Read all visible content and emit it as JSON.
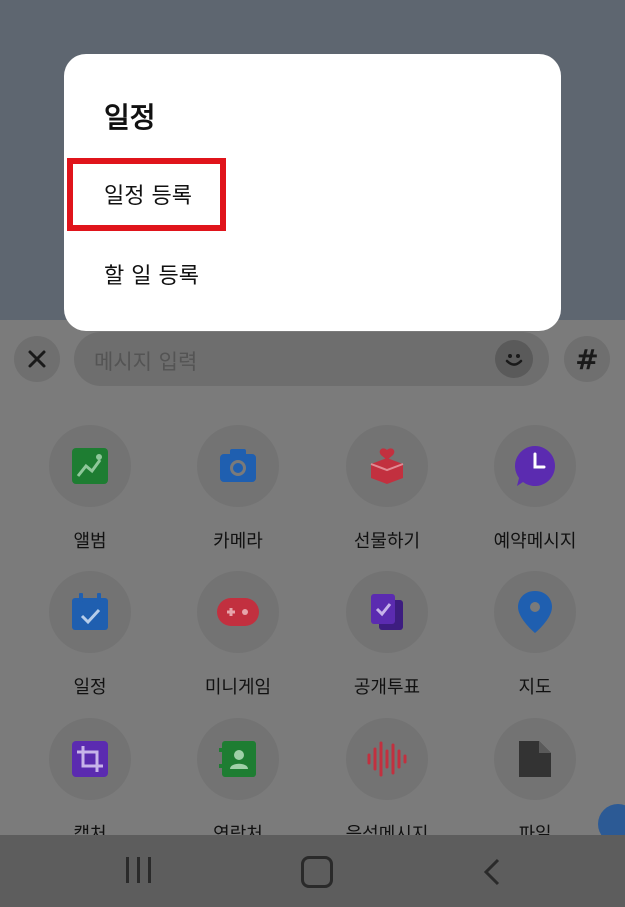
{
  "popup": {
    "title": "일정",
    "options": [
      "일정 등록",
      "할 일 등록"
    ]
  },
  "input": {
    "placeholder": "메시지 입력",
    "hash_label": "#"
  },
  "grid": [
    {
      "label": "앨범",
      "icon": "album-icon",
      "color": "#1e7d32"
    },
    {
      "label": "카메라",
      "icon": "camera-icon",
      "color": "#1f5fb0"
    },
    {
      "label": "선물하기",
      "icon": "gift-icon",
      "color": "#c2303f"
    },
    {
      "label": "예약메시지",
      "icon": "clock-message-icon",
      "color": "#5b2bb0"
    },
    {
      "label": "일정",
      "icon": "calendar-icon",
      "color": "#1f5fb0"
    },
    {
      "label": "미니게임",
      "icon": "gamepad-icon",
      "color": "#c2303f"
    },
    {
      "label": "공개투표",
      "icon": "vote-icon",
      "color": "#5b2bb0"
    },
    {
      "label": "지도",
      "icon": "map-pin-icon",
      "color": "#1f5fb0"
    },
    {
      "label": "캡처",
      "icon": "crop-icon",
      "color": "#5b2bb0"
    },
    {
      "label": "연락처",
      "icon": "contact-icon",
      "color": "#1e7d32"
    },
    {
      "label": "음성메시지",
      "icon": "voice-wave-icon",
      "color": "#c2303f"
    },
    {
      "label": "파일",
      "icon": "file-icon",
      "color": "#333333"
    }
  ],
  "colors": {
    "highlight": "#e0141b",
    "popup_bg": "#ffffff",
    "overlay_top": "#5e6670"
  }
}
